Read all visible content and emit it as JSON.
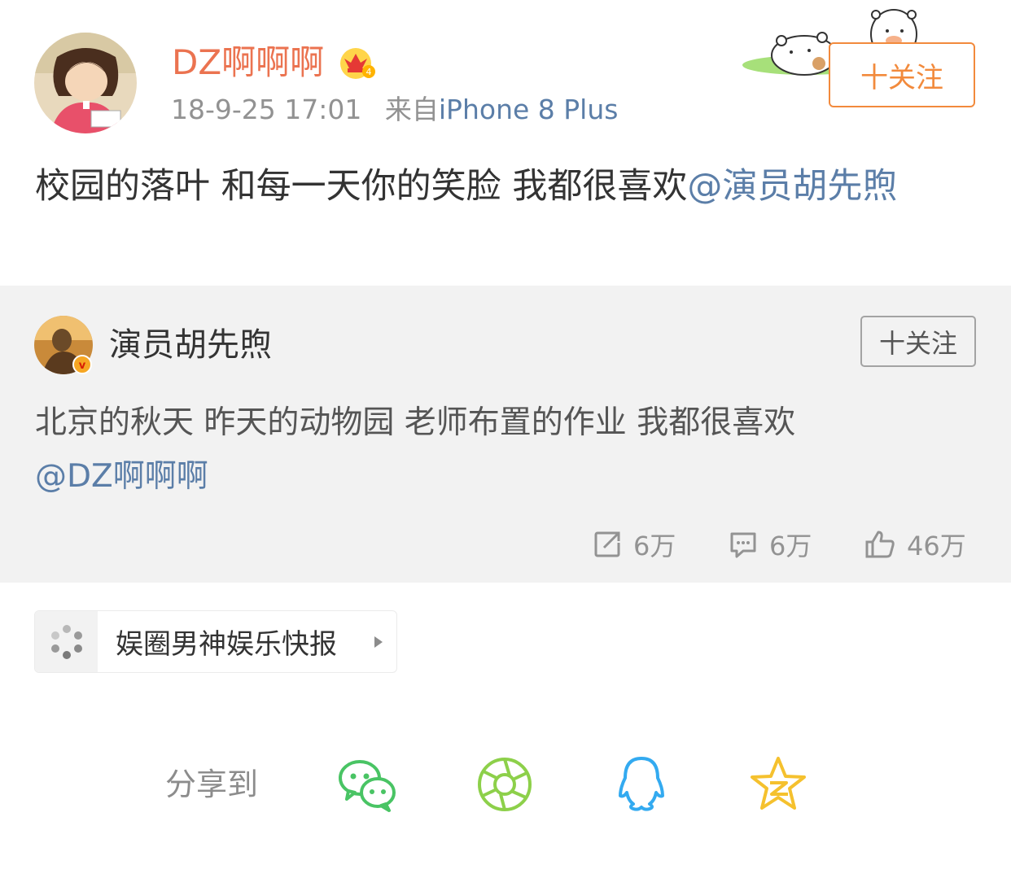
{
  "post": {
    "author": "DZ啊啊啊",
    "timestamp": "18-9-25 17:01",
    "source_prefix": "来自",
    "source": "iPhone 8 Plus",
    "follow_label": "十关注",
    "text": "校园的落叶 和每一天你的笑脸 我都很喜欢",
    "mention": "@演员胡先煦"
  },
  "repost": {
    "author": "演员胡先煦",
    "follow_label": "十关注",
    "text": "北京的秋天 昨天的动物园 老师布置的作业 我都很喜欢",
    "mention": "@DZ啊啊啊",
    "stats": {
      "reposts": "6万",
      "comments": "6万",
      "likes": "46万"
    }
  },
  "source_chip": {
    "label": "娱圈男神娱乐快报"
  },
  "share": {
    "label": "分享到",
    "targets": [
      "wechat-icon",
      "moments-icon",
      "qq-icon",
      "qzone-icon"
    ]
  },
  "colors": {
    "username": "#eb7350",
    "link": "#5b7ea8",
    "follow": "#f28a3c",
    "repost_bg": "#f2f2f2"
  }
}
